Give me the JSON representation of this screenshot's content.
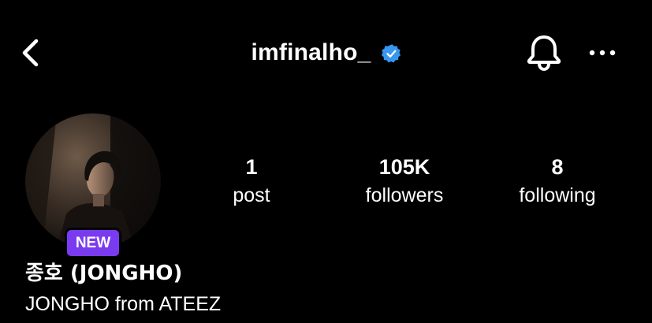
{
  "header": {
    "username": "imfinalho_",
    "verified": true,
    "back_icon": "chevron-left-icon",
    "bell_icon": "bell-icon",
    "more_icon": "more-horizontal-icon",
    "verified_color": "#3897f0"
  },
  "profile": {
    "avatar_icon": "profile-photo",
    "badge": "NEW",
    "badge_color": "#7a3bf0",
    "display_name": "종호 (JONGHO)",
    "bio": "JONGHO from ATEEZ"
  },
  "stats": {
    "posts": {
      "value": "1",
      "label": "post"
    },
    "followers": {
      "value": "105K",
      "label": "followers"
    },
    "following": {
      "value": "8",
      "label": "following"
    }
  },
  "theme": {
    "background": "#000000",
    "text": "#ffffff"
  }
}
